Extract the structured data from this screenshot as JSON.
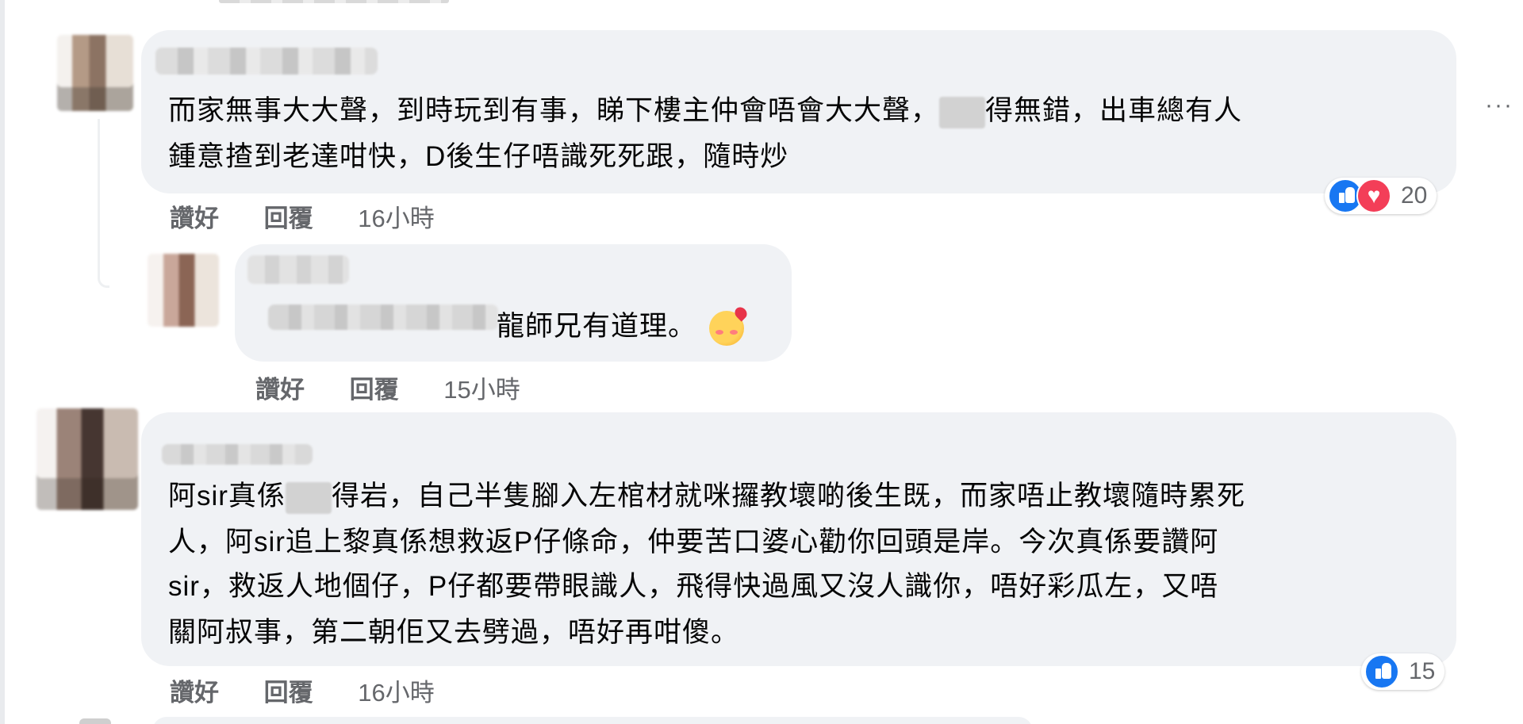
{
  "comments": [
    {
      "author_hidden": true,
      "text_line1_before": "而家無事大大聲，到時玩到有事，睇下樓主仲會唔會大大聲，",
      "text_line1_after": "得無錯，出車總有人",
      "text_line2": "鍾意揸到老達咁快，D後生仔唔識死死跟，隨時炒",
      "actions": {
        "like": "讚好",
        "reply": "回覆",
        "time": "16小時"
      },
      "reactions": {
        "icons": [
          "like-icon",
          "love-icon"
        ],
        "count": "20"
      }
    },
    {
      "author_hidden": true,
      "is_reply": true,
      "text": "龍師兄有道理。",
      "emoji": "smiling-face-with-hearts",
      "actions": {
        "like": "讚好",
        "reply": "回覆",
        "time": "15小時"
      }
    },
    {
      "author_hidden": true,
      "text_line1_before": "阿sir真係",
      "text_line1_after": "得岩，自己半隻腳入左棺材就咪攞教壞啲後生既，而家唔止教壞隨時累死",
      "text_line2": "人，阿sir追上黎真係想救返P仔條命，仲要苦口婆心勸你回頭是岸。今次真係要讚阿",
      "text_line3": "sir，救返人地個仔，P仔都要帶眼識人，飛得快過風又沒人識你，唔好彩瓜左，又唔",
      "text_line4": "關阿叔事，第二朝佢又去劈過，唔好再咁傻。",
      "actions": {
        "like": "讚好",
        "reply": "回覆",
        "time": "16小時"
      },
      "reactions": {
        "icons": [
          "like-icon"
        ],
        "count": "15"
      }
    }
  ],
  "menu": {
    "more_label": "···"
  },
  "colors": {
    "bubble": "#f0f2f5",
    "like_blue": "#1877f2",
    "love_red": "#f33e58",
    "meta_gray": "#65676b"
  }
}
